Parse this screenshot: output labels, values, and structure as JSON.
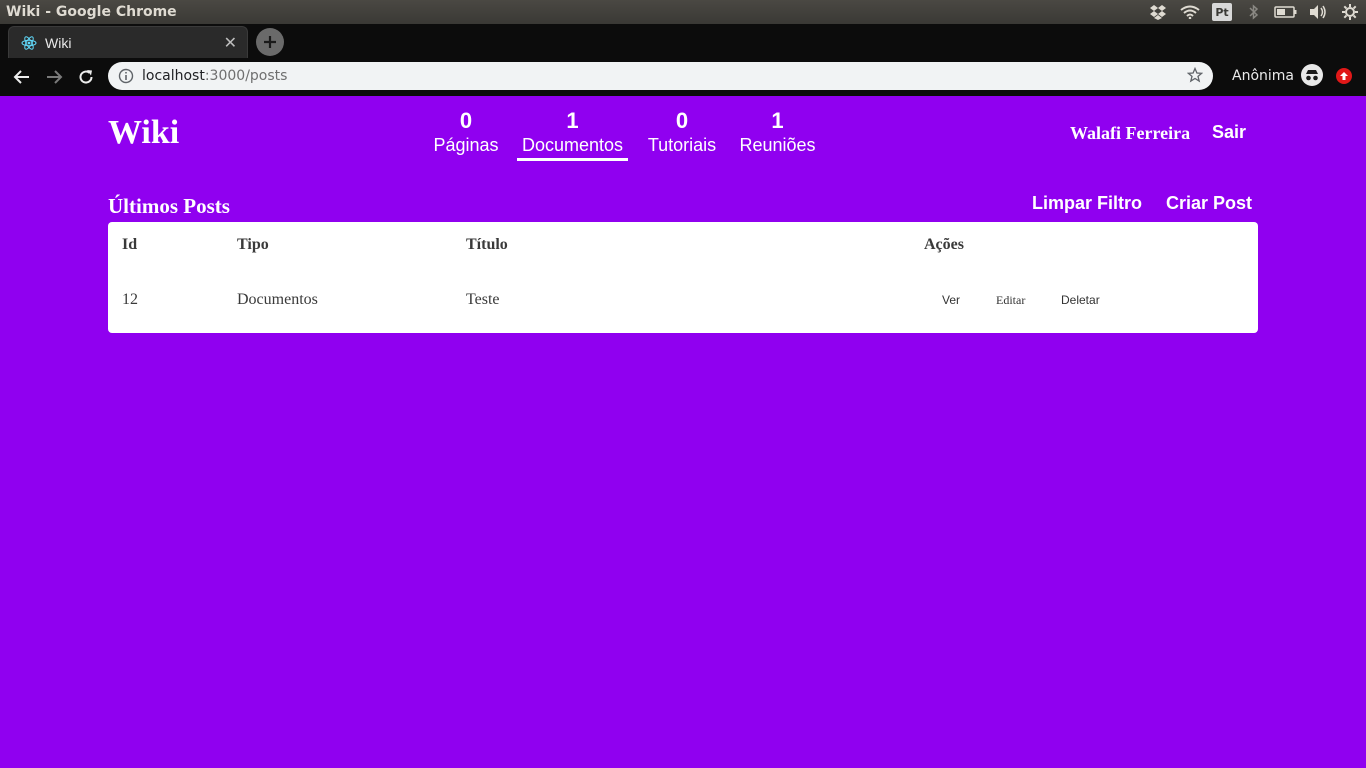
{
  "os": {
    "window_title": "Wiki - Google Chrome",
    "tray_badge": "Pt"
  },
  "browser": {
    "tab_title": "Wiki",
    "url_host": "localhost",
    "url_path": ":3000/posts",
    "incognito_label": "Anônima"
  },
  "app": {
    "logo": "Wiki",
    "stats": [
      {
        "count": "0",
        "label": "Páginas",
        "active": false
      },
      {
        "count": "1",
        "label": "Documentos",
        "active": true
      },
      {
        "count": "0",
        "label": "Tutoriais",
        "active": false
      },
      {
        "count": "1",
        "label": "Reuniões",
        "active": false
      }
    ],
    "user_name": "Walafi Ferreira",
    "logout_label": "Sair"
  },
  "posts": {
    "title": "Últimos Posts",
    "clear_filter_label": "Limpar Filtro",
    "create_post_label": "Criar Post",
    "columns": [
      "Id",
      "Tipo",
      "Título",
      "Ações"
    ],
    "rows": [
      {
        "id": "12",
        "type": "Documentos",
        "title": "Teste",
        "actions": [
          "Ver",
          "Editar",
          "Deletar"
        ]
      }
    ]
  },
  "colors": {
    "page_background": "#9000f0",
    "card_background": "#ffffff"
  }
}
